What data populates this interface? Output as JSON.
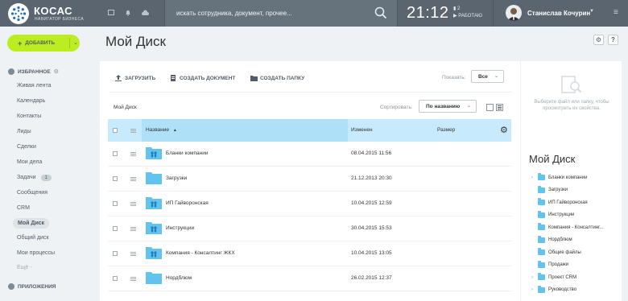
{
  "header": {
    "logo_title": "КОСАС",
    "logo_subtitle": "НАВИГАТОР БИЗНЕСА",
    "search_placeholder": "искать сотрудника, документ, прочее...",
    "clock": "21:12",
    "clock_count": "2",
    "status": "РАБОТАЮ",
    "username": "Станислав Кочурин"
  },
  "sidebar": {
    "add_button": "ДОБАВИТЬ",
    "favorites_title": "ИЗБРАННОЕ",
    "items": [
      {
        "label": "Живая лента"
      },
      {
        "label": "Календарь"
      },
      {
        "label": "Контакты"
      },
      {
        "label": "Лиды"
      },
      {
        "label": "Сделки"
      },
      {
        "label": "Мои дела"
      },
      {
        "label": "Задачи",
        "badge": "1"
      },
      {
        "label": "Сообщения"
      },
      {
        "label": "CRM"
      },
      {
        "label": "Мой Диск",
        "active": true
      },
      {
        "label": "Общий диск"
      },
      {
        "label": "Мои процессы"
      },
      {
        "label": "Ещё -"
      }
    ],
    "apps_title": "ПРИЛОЖЕНИЯ"
  },
  "main": {
    "title": "Мой Диск",
    "toolbar": {
      "upload": "ЗАГРУЗИТЬ",
      "create_doc": "СОЗДАТЬ ДОКУМЕНТ",
      "create_folder": "СОЗДАТЬ ПАПКУ",
      "show_label": "Показать:",
      "show_value": "Все"
    },
    "breadcrumb": "Мой Диск",
    "sort_label": "Сортировать:",
    "sort_value": "По названию",
    "columns": {
      "name": "Название",
      "modified": "Изменен",
      "size": "Размер"
    },
    "rows": [
      {
        "name": "Бланки компании",
        "date": "08.04.2015 11:56",
        "shared": true
      },
      {
        "name": "Загрузки",
        "date": "21.12.2013 20:30",
        "shared": false
      },
      {
        "name": "ИП Гайворонская",
        "date": "10.04.2015 12:59",
        "shared": true
      },
      {
        "name": "Инструкции",
        "date": "30.04.2015 15:53",
        "shared": true
      },
      {
        "name": "Компания - Консалтинг ЖКХ",
        "date": "10.04.2015 13:05",
        "shared": true
      },
      {
        "name": "Нордблюм",
        "date": "26.02.2015 12:37",
        "shared": false
      }
    ]
  },
  "right_panel": {
    "empty_text": "Выберите файл или папку, чтобы просмотреть их свойства.",
    "tree_title": "Мой Диск",
    "tree": [
      {
        "label": "Бланки компании",
        "arrow": true
      },
      {
        "label": "Загрузки",
        "arrow": false
      },
      {
        "label": "ИП Гайворонская",
        "arrow": false
      },
      {
        "label": "Инструкции",
        "arrow": false
      },
      {
        "label": "Компания - Консалтинг...",
        "arrow": false
      },
      {
        "label": "Нордблюм",
        "arrow": false
      },
      {
        "label": "Общие файлы",
        "arrow": false
      },
      {
        "label": "Продажи",
        "arrow": false
      },
      {
        "label": "Проект CRM",
        "arrow": true
      },
      {
        "label": "Руководство",
        "arrow": true
      }
    ]
  },
  "colors": {
    "header_bg": "#5a6570",
    "accent_green": "#bbed21",
    "table_head": "#c7eafc",
    "folder": "#62c3ee"
  }
}
